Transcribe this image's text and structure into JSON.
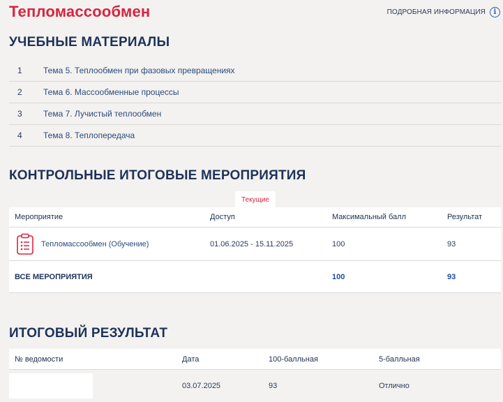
{
  "header": {
    "title": "Тепломассообмен",
    "info_link": "ПОДРОБНАЯ ИНФОРМАЦИЯ",
    "info_icon": "info-icon"
  },
  "materials": {
    "title": "УЧЕБНЫЕ МАТЕРИАЛЫ",
    "items": [
      {
        "num": "1",
        "label": "Тема 5. Теплообмен при фазовых превращениях"
      },
      {
        "num": "2",
        "label": "Тема 6. Массообменные процессы"
      },
      {
        "num": "3",
        "label": "Тема 7. Лучистый теплообмен"
      },
      {
        "num": "4",
        "label": "Тема 8. Теплопередача"
      }
    ]
  },
  "events": {
    "title": "КОНТРОЛЬНЫЕ ИТОГОВЫЕ МЕРОПРИЯТИЯ",
    "tab": "Текущие",
    "columns": [
      "Мероприятие",
      "Доступ",
      "Максимальный балл",
      "Результат"
    ],
    "rows": [
      {
        "name": "Тепломассообмен (Обучение)",
        "access": "01.06.2025 - 15.11.2025",
        "max": "100",
        "result": "93",
        "icon": "clipboard-icon"
      }
    ],
    "total": {
      "label": "ВСЕ МЕРОПРИЯТИЯ",
      "max": "100",
      "result": "93"
    }
  },
  "final": {
    "title": "ИТОГОВЫЙ РЕЗУЛЬТАТ",
    "columns": [
      "№ ведомости",
      "Дата",
      "100-балльная",
      "5-балльная"
    ],
    "rows": [
      {
        "sheet": "",
        "date": "03.07.2025",
        "score100": "93",
        "score5": "Отлично"
      }
    ]
  },
  "colors": {
    "accent": "#d8243f",
    "heading": "#1e3259",
    "background": "#f3f2f0"
  }
}
